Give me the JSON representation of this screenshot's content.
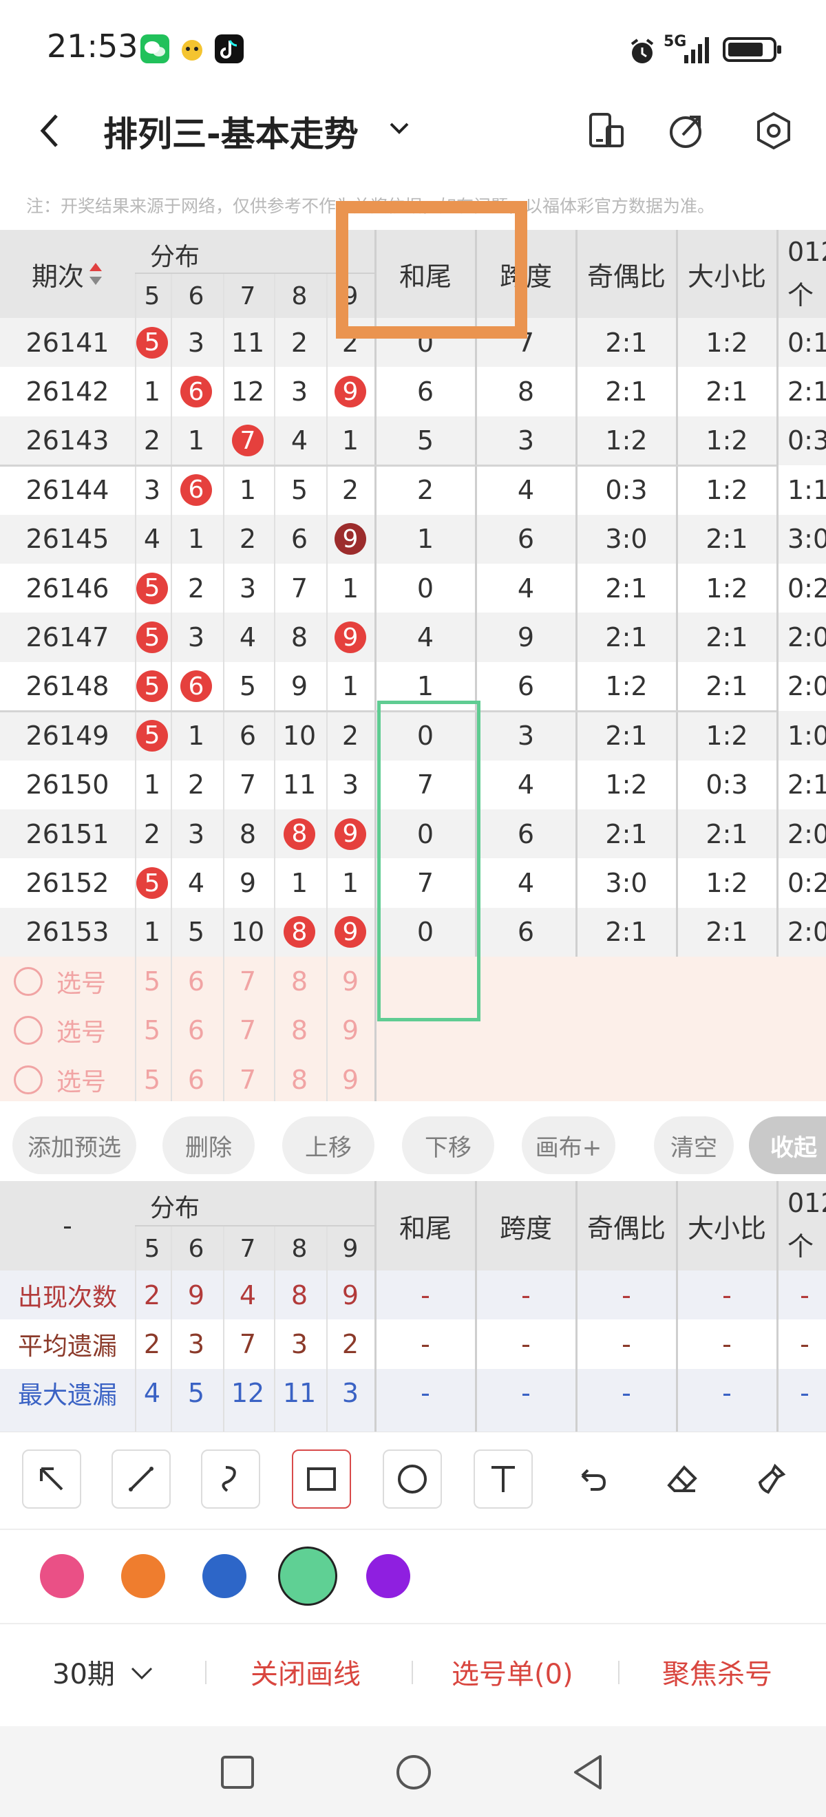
{
  "status_bar": {
    "time": "21:53",
    "network": "5G",
    "app_icons": [
      "wechat-icon",
      "mascot-icon",
      "tiktok-icon"
    ],
    "right_icons": [
      "alarm-icon",
      "signal-icon",
      "battery-icon"
    ]
  },
  "header": {
    "title": "排列三-基本走势",
    "icons": [
      "back-icon",
      "chevron-down-icon",
      "phone-icon",
      "share-icon",
      "settings-icon"
    ]
  },
  "note": "注：开奖结果来源于网络，仅供参考不作为兑奖依据，如有问题，以福体彩官方数据为准。",
  "table": {
    "headers": {
      "period": "期次",
      "dist_group": "分布",
      "sum_tail": "和尾",
      "span": "跨度",
      "odd_even": "奇偶比",
      "big_small": "大小比",
      "zero12": "012",
      "zero12_sub": "个数"
    },
    "digit_cols": [
      "5",
      "6",
      "7",
      "8",
      "9"
    ],
    "rows": [
      {
        "period": "26141",
        "d": [
          "5",
          "3",
          "11",
          "2",
          "2"
        ],
        "hits": [
          0
        ],
        "sum_tail": "0",
        "span": "7",
        "odd_even": "2:1",
        "big_small": "1:2",
        "z": "0:1"
      },
      {
        "period": "26142",
        "d": [
          "1",
          "6",
          "12",
          "3",
          "9"
        ],
        "hits": [
          1,
          4
        ],
        "sum_tail": "6",
        "span": "8",
        "odd_even": "2:1",
        "big_small": "2:1",
        "z": "2:1"
      },
      {
        "period": "26143",
        "d": [
          "2",
          "1",
          "7",
          "4",
          "1"
        ],
        "hits": [
          2
        ],
        "sum_tail": "5",
        "span": "3",
        "odd_even": "1:2",
        "big_small": "1:2",
        "z": "0:3"
      },
      {
        "period": "26144",
        "d": [
          "3",
          "6",
          "1",
          "5",
          "2"
        ],
        "hits": [
          1
        ],
        "sum_tail": "2",
        "span": "4",
        "odd_even": "0:3",
        "big_small": "1:2",
        "z": "1:1"
      },
      {
        "period": "26145",
        "d": [
          "4",
          "1",
          "2",
          "6",
          "9"
        ],
        "hits": [
          4
        ],
        "dark": [
          4
        ],
        "sum_tail": "1",
        "span": "6",
        "odd_even": "3:0",
        "big_small": "2:1",
        "z": "3:0"
      },
      {
        "period": "26146",
        "d": [
          "5",
          "2",
          "3",
          "7",
          "1"
        ],
        "hits": [
          0
        ],
        "sum_tail": "0",
        "span": "4",
        "odd_even": "2:1",
        "big_small": "1:2",
        "z": "0:2"
      },
      {
        "period": "26147",
        "d": [
          "5",
          "3",
          "4",
          "8",
          "9"
        ],
        "hits": [
          0,
          4
        ],
        "sum_tail": "4",
        "span": "9",
        "odd_even": "2:1",
        "big_small": "2:1",
        "z": "2:0"
      },
      {
        "period": "26148",
        "d": [
          "5",
          "6",
          "5",
          "9",
          "1"
        ],
        "hits": [
          0,
          1
        ],
        "sum_tail": "1",
        "span": "6",
        "odd_even": "1:2",
        "big_small": "2:1",
        "z": "2:0"
      },
      {
        "period": "26149",
        "d": [
          "5",
          "1",
          "6",
          "10",
          "2"
        ],
        "hits": [
          0
        ],
        "sum_tail": "0",
        "span": "3",
        "odd_even": "2:1",
        "big_small": "1:2",
        "z": "1:0"
      },
      {
        "period": "26150",
        "d": [
          "1",
          "2",
          "7",
          "11",
          "3"
        ],
        "hits": [],
        "sum_tail": "7",
        "span": "4",
        "odd_even": "1:2",
        "big_small": "0:3",
        "z": "2:1"
      },
      {
        "period": "26151",
        "d": [
          "2",
          "3",
          "8",
          "8",
          "9"
        ],
        "hits": [
          3,
          4
        ],
        "sum_tail": "0",
        "span": "6",
        "odd_even": "2:1",
        "big_small": "2:1",
        "z": "2:0"
      },
      {
        "period": "26152",
        "d": [
          "5",
          "4",
          "9",
          "1",
          "1"
        ],
        "hits": [
          0
        ],
        "sum_tail": "7",
        "span": "4",
        "odd_even": "3:0",
        "big_small": "1:2",
        "z": "0:2"
      },
      {
        "period": "26153",
        "d": [
          "1",
          "5",
          "10",
          "8",
          "9"
        ],
        "hits": [
          3,
          4
        ],
        "sum_tail": "0",
        "span": "6",
        "odd_even": "2:1",
        "big_small": "2:1",
        "z": "2:0"
      }
    ],
    "pick_rows": [
      {
        "label": "选号",
        "d": [
          "5",
          "6",
          "7",
          "8",
          "9"
        ]
      },
      {
        "label": "选号",
        "d": [
          "5",
          "6",
          "7",
          "8",
          "9"
        ]
      },
      {
        "label": "选号",
        "d": [
          "5",
          "6",
          "7",
          "8",
          "9"
        ]
      }
    ]
  },
  "actions": [
    "添加预选",
    "删除",
    "上移",
    "下移",
    "画布+",
    "清空",
    "收起"
  ],
  "stats": {
    "dash": "-",
    "headers": {
      "dist_group": "分布",
      "sum_tail": "和尾",
      "span": "跨度",
      "odd_even": "奇偶比",
      "big_small": "大小比",
      "zero12": "012",
      "zero12_sub": "个数"
    },
    "digit_cols": [
      "5",
      "6",
      "7",
      "8",
      "9"
    ],
    "rows": [
      {
        "label": "出现次数",
        "color": "#b23a3a",
        "d": [
          "2",
          "9",
          "4",
          "8",
          "9"
        ],
        "rest": [
          "-",
          "-",
          "-",
          "-",
          "-"
        ]
      },
      {
        "label": "平均遗漏",
        "color": "#8b3a2a",
        "d": [
          "2",
          "3",
          "7",
          "3",
          "2"
        ],
        "rest": [
          "-",
          "-",
          "-",
          "-",
          "-"
        ]
      },
      {
        "label": "最大遗漏",
        "color": "#3a62c4",
        "d": [
          "4",
          "5",
          "12",
          "11",
          "3"
        ],
        "rest": [
          "-",
          "-",
          "-",
          "-",
          "-"
        ]
      }
    ]
  },
  "draw_tools": [
    "arrow-tool-icon",
    "line-tool-icon",
    "curve-tool-icon",
    "rect-tool-icon",
    "circle-tool-icon",
    "text-tool-icon",
    "undo-icon",
    "eraser-icon",
    "brush-clear-icon"
  ],
  "colors": [
    "#ea5086",
    "#ef7d2e",
    "#2d66c8",
    "#5fd094",
    "#8f1fe0"
  ],
  "footer": {
    "period_select": "30期",
    "close_draw": "关闭画线",
    "pick_list": "选号单(0)",
    "focus_kill": "聚焦杀号"
  },
  "accent": "#d9463f"
}
